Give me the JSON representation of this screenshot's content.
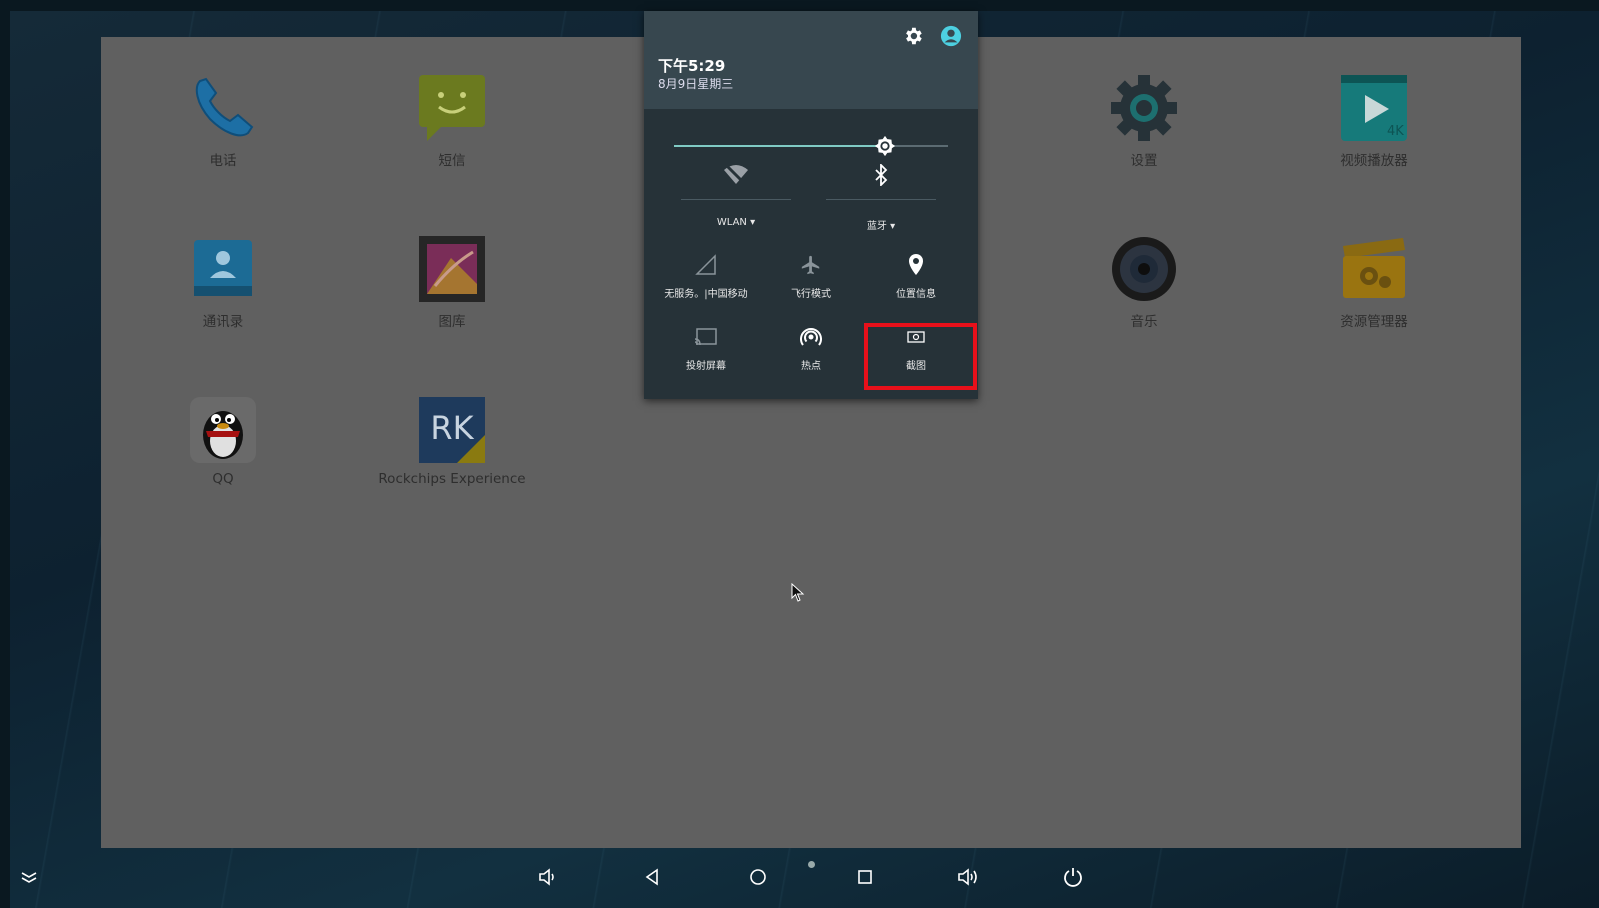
{
  "apps": [
    {
      "label": "电话",
      "icon": "phone-icon"
    },
    {
      "label": "短信",
      "icon": "messaging-icon"
    },
    {
      "label": "设置",
      "icon": "settings-gear-icon"
    },
    {
      "label": "视频播放器",
      "icon": "video-player-icon"
    },
    {
      "label": "通讯录",
      "icon": "contacts-icon"
    },
    {
      "label": "图库",
      "icon": "gallery-icon"
    },
    {
      "label": "音乐",
      "icon": "music-speaker-icon"
    },
    {
      "label": "资源管理器",
      "icon": "file-manager-icon"
    },
    {
      "label": "QQ",
      "icon": "qq-penguin-icon"
    },
    {
      "label": "Rockchips Experience",
      "icon": "rk-icon"
    }
  ],
  "rk_icon_text": "RK",
  "video_icon_text": "4K",
  "quick_settings": {
    "time": "下午5:29",
    "date": "8月9日星期三",
    "brightness_level": 0.77,
    "wifi_label": "WLAN",
    "bluetooth_label": "蓝牙",
    "tiles": [
      {
        "label": "无服务。|中国移动",
        "icon": "cellular-signal-icon"
      },
      {
        "label": "飞行模式",
        "icon": "airplane-icon"
      },
      {
        "label": "位置信息",
        "icon": "location-pin-icon"
      },
      {
        "label": "投射屏幕",
        "icon": "cast-icon"
      },
      {
        "label": "热点",
        "icon": "hotspot-icon"
      },
      {
        "label": "截图",
        "icon": "screenshot-icon"
      }
    ]
  },
  "colors": {
    "highlight": "#e8101a",
    "accent": "#4dd0e1",
    "slider": "#80cbc4"
  }
}
